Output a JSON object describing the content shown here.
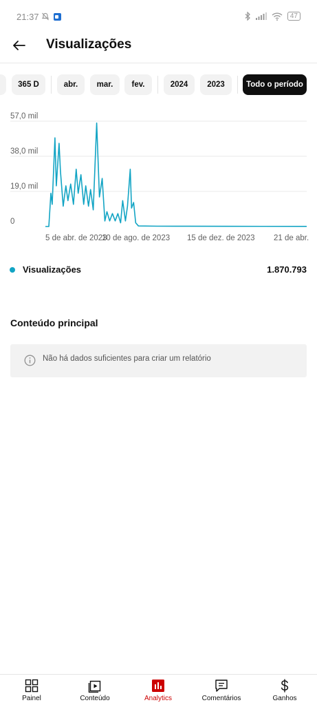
{
  "status_bar": {
    "time": "21:37",
    "battery": "47"
  },
  "header": {
    "title": "Visualizações"
  },
  "filters": {
    "chips": [
      "365 D",
      "abr.",
      "mar.",
      "fev.",
      "2024",
      "2023",
      "Todo o período"
    ],
    "selected": "Todo o período"
  },
  "chart_data": {
    "type": "line",
    "title": "",
    "xlabel": "",
    "ylabel": "",
    "ylim": [
      0,
      57000
    ],
    "y_ticks": [
      "57,0 mil",
      "38,0 mil",
      "19,0 mil",
      "0"
    ],
    "x_ticks": [
      "5 de abr. de 2023",
      "10 de ago. de 2023",
      "15 de dez. de 2023",
      "21 de abr."
    ],
    "x_range": [
      "2023-04-05",
      "2024-04-21"
    ],
    "series": [
      {
        "name": "Visualizações",
        "color": "#12a4c4",
        "points": [
          [
            "2023-04-05",
            0
          ],
          [
            "2023-04-10",
            0
          ],
          [
            "2023-04-13",
            18000
          ],
          [
            "2023-04-15",
            12000
          ],
          [
            "2023-04-19",
            48000
          ],
          [
            "2023-04-21",
            22000
          ],
          [
            "2023-04-25",
            45000
          ],
          [
            "2023-04-27",
            30000
          ],
          [
            "2023-05-01",
            11000
          ],
          [
            "2023-05-05",
            22000
          ],
          [
            "2023-05-08",
            14000
          ],
          [
            "2023-05-12",
            23000
          ],
          [
            "2023-05-16",
            12000
          ],
          [
            "2023-05-20",
            31000
          ],
          [
            "2023-05-23",
            18000
          ],
          [
            "2023-05-27",
            28000
          ],
          [
            "2023-05-31",
            12000
          ],
          [
            "2023-06-03",
            22000
          ],
          [
            "2023-06-07",
            11000
          ],
          [
            "2023-06-10",
            20000
          ],
          [
            "2023-06-14",
            9000
          ],
          [
            "2023-06-19",
            56000
          ],
          [
            "2023-06-23",
            16000
          ],
          [
            "2023-06-27",
            26000
          ],
          [
            "2023-07-01",
            3000
          ],
          [
            "2023-07-04",
            8000
          ],
          [
            "2023-07-08",
            3000
          ],
          [
            "2023-07-12",
            7000
          ],
          [
            "2023-07-16",
            3000
          ],
          [
            "2023-07-20",
            7000
          ],
          [
            "2023-07-24",
            2000
          ],
          [
            "2023-07-27",
            14000
          ],
          [
            "2023-07-31",
            3000
          ],
          [
            "2023-08-03",
            11000
          ],
          [
            "2023-08-07",
            31000
          ],
          [
            "2023-08-09",
            10000
          ],
          [
            "2023-08-12",
            13000
          ],
          [
            "2023-08-15",
            2000
          ],
          [
            "2023-08-19",
            300
          ],
          [
            "2023-09-15",
            200
          ],
          [
            "2023-11-01",
            150
          ],
          [
            "2024-01-01",
            100
          ],
          [
            "2024-04-21",
            80
          ]
        ]
      }
    ]
  },
  "summary": {
    "metric_label": "Visualizações",
    "metric_value": "1.870.793"
  },
  "top_content": {
    "title": "Conteúdo principal",
    "empty_message": "Não há dados suficientes para criar um relatório"
  },
  "bottom_nav": [
    {
      "label": "Painel",
      "icon": "dashboard-icon"
    },
    {
      "label": "Conteúdo",
      "icon": "content-icon"
    },
    {
      "label": "Analytics",
      "icon": "analytics-icon",
      "active": true
    },
    {
      "label": "Comentários",
      "icon": "comments-icon"
    },
    {
      "label": "Ganhos",
      "icon": "earnings-icon"
    }
  ],
  "colors": {
    "accent": "#12a4c4",
    "active_tab": "#cc0000",
    "selected_chip": "#0f0f0f"
  }
}
